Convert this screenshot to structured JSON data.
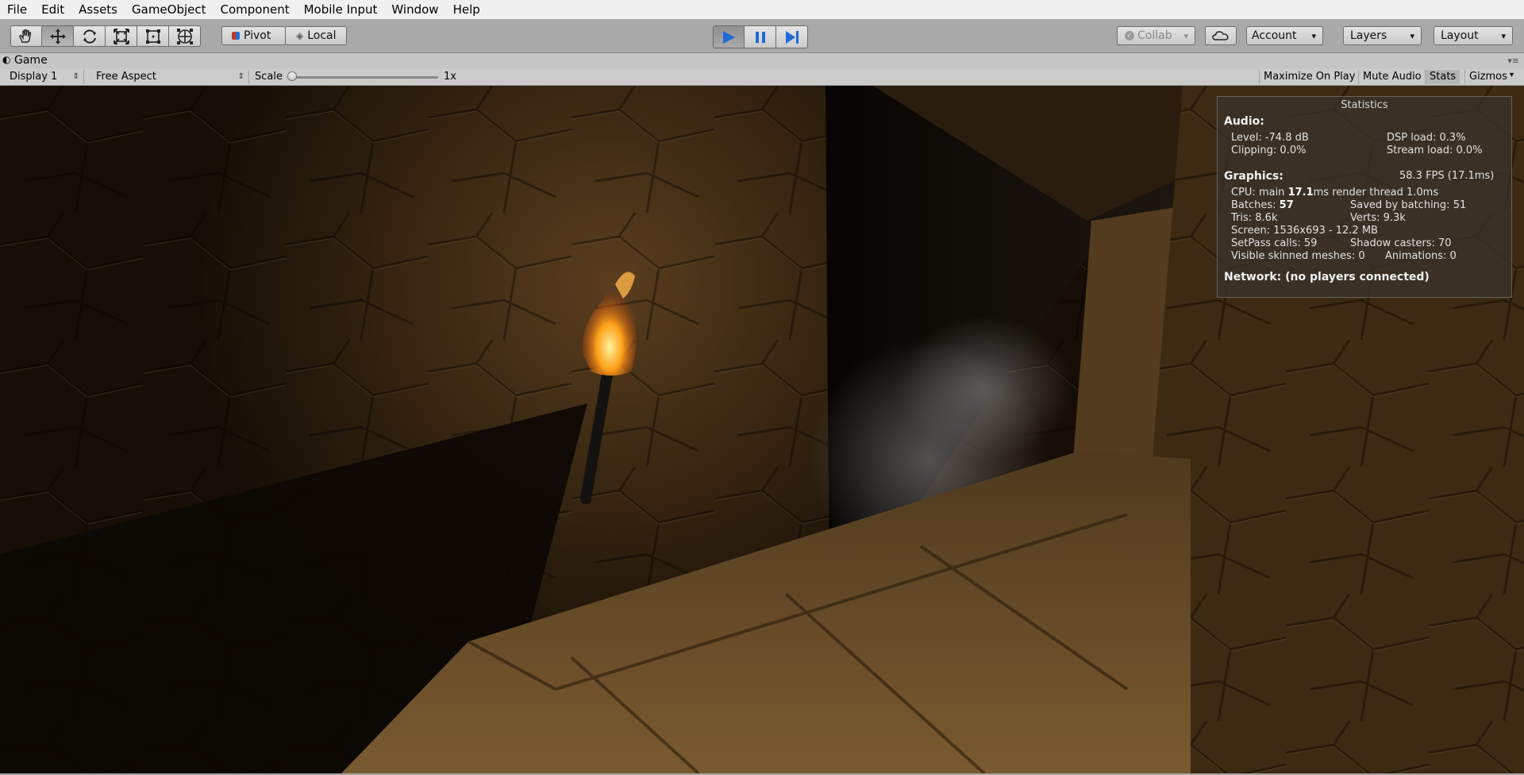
{
  "menu": [
    "File",
    "Edit",
    "Assets",
    "GameObject",
    "Component",
    "Mobile Input",
    "Window",
    "Help"
  ],
  "toolbar": {
    "tools": [
      {
        "name": "hand-tool-icon"
      },
      {
        "name": "move-tool-icon"
      },
      {
        "name": "rotate-tool-icon"
      },
      {
        "name": "scale-tool-icon"
      },
      {
        "name": "rect-tool-icon"
      },
      {
        "name": "transform-tool-icon"
      }
    ],
    "pivot_label": "Pivot",
    "local_label": "Local",
    "collab_label": "Collab",
    "account_label": "Account",
    "layers_label": "Layers",
    "layout_label": "Layout",
    "play_color": "#1e6ad6"
  },
  "game_tab": {
    "title": "Game"
  },
  "game_toolbar": {
    "display": "Display 1",
    "aspect": "Free Aspect",
    "scale_label": "Scale",
    "scale_value": "1x",
    "scale_fraction": 0,
    "maximize": "Maximize On Play",
    "mute": "Mute Audio",
    "stats": "Stats",
    "gizmos": "Gizmos"
  },
  "stats": {
    "title": "Statistics",
    "audio_header": "Audio:",
    "level": "Level: -74.8 dB",
    "clipping": "Clipping: 0.0%",
    "dsp": "DSP load: 0.3%",
    "stream": "Stream load: 0.0%",
    "graphics_header": "Graphics:",
    "fps": "58.3 FPS (17.1ms)",
    "cpu_prefix": "CPU: main ",
    "cpu_main": "17.1",
    "cpu_suffix": "ms  render thread 1.0ms",
    "batches_prefix": "Batches: ",
    "batches": "57",
    "saved": "Saved by batching: 51",
    "tris": "Tris: 8.6k",
    "verts": "Verts: 9.3k",
    "screen": "Screen: 1536x693 - 12.2 MB",
    "setpass": "SetPass calls: 59",
    "shadow": "Shadow casters: 70",
    "skinned": "Visible skinned meshes: 0",
    "animations": "Animations: 0",
    "network": "Network: (no players connected)"
  }
}
